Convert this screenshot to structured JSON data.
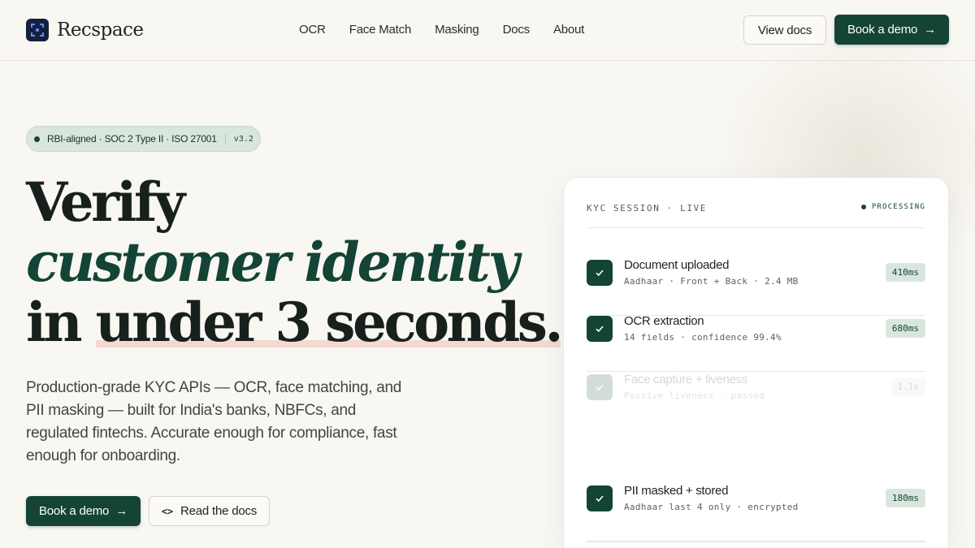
{
  "brand": {
    "name": "Recspace",
    "logo_icon": "scan-frame-icon",
    "logo_color": "#14213d"
  },
  "nav": {
    "links": [
      "OCR",
      "Face Match",
      "Masking",
      "Docs",
      "About"
    ],
    "view_docs": "View docs",
    "book_demo": "Book a demo",
    "arrow": "→"
  },
  "hero": {
    "badge": {
      "text": "RBI-aligned · SOC 2 Type II · ISO 27001",
      "version": "v3.2"
    },
    "headline": {
      "line1": "Verify",
      "line2": "customer identity",
      "line3_pre": "in ",
      "line3_highlight": "under 3 seconds."
    },
    "subcopy": "Production-grade KYC APIs — OCR, face matching, and PII masking — built for India's banks, NBFCs, and regulated fintechs. Accurate enough for compliance, fast enough for onboarding.",
    "cta_primary": "Book a demo",
    "cta_arrow": "→",
    "cta_secondary": "Read the docs",
    "cta_secondary_icon": "<>"
  },
  "session": {
    "title": "KYC SESSION · LIVE",
    "status": "PROCESSING",
    "steps": [
      {
        "title": "Document uploaded",
        "meta": "Aadhaar · Front + Back · 2.4 MB",
        "time": "410ms",
        "state": "done"
      },
      {
        "title": "OCR extraction",
        "meta": "14 fields · confidence 99.4%",
        "time": "680ms",
        "state": "done"
      },
      {
        "title": "Face capture + liveness",
        "meta": "Passive liveness · passed",
        "time": "1.1s",
        "state": "pending"
      },
      {
        "title": "PII masked + stored",
        "meta": "Aadhaar last 4 only · encrypted",
        "time": "180ms",
        "state": "done"
      }
    ]
  },
  "colors": {
    "accent": "#134436",
    "background": "#f9f7f2",
    "badge_bg": "#d9e6dd",
    "highlight": "#f3d9cf"
  }
}
